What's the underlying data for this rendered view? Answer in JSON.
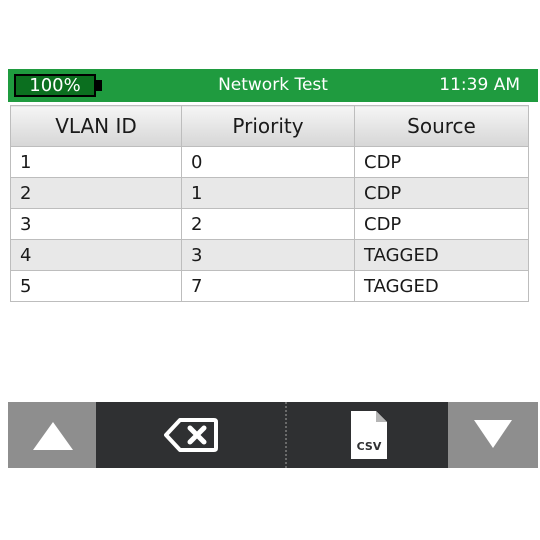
{
  "status_bar": {
    "battery_level": "100%",
    "title": "Network Test",
    "time": "11:39 AM"
  },
  "table": {
    "columns": [
      "VLAN ID",
      "Priority",
      "Source"
    ],
    "rows": [
      [
        "1",
        "0",
        "CDP"
      ],
      [
        "2",
        "1",
        "CDP"
      ],
      [
        "3",
        "2",
        "CDP"
      ],
      [
        "4",
        "3",
        "TAGGED"
      ],
      [
        "5",
        "7",
        "TAGGED"
      ]
    ]
  },
  "toolbar": {
    "up_icon": "triangle-up-icon",
    "clear_icon": "backspace-icon",
    "csv_icon": "csv-file-icon",
    "csv_label": "CSV",
    "down_icon": "triangle-down-icon"
  },
  "colors": {
    "status_bar_bg": "#1f9b3f",
    "battery_fill": "#0b6f1f",
    "toolbar_bg": "#2f3032",
    "arrow_button_bg": "#8e8e8e"
  }
}
